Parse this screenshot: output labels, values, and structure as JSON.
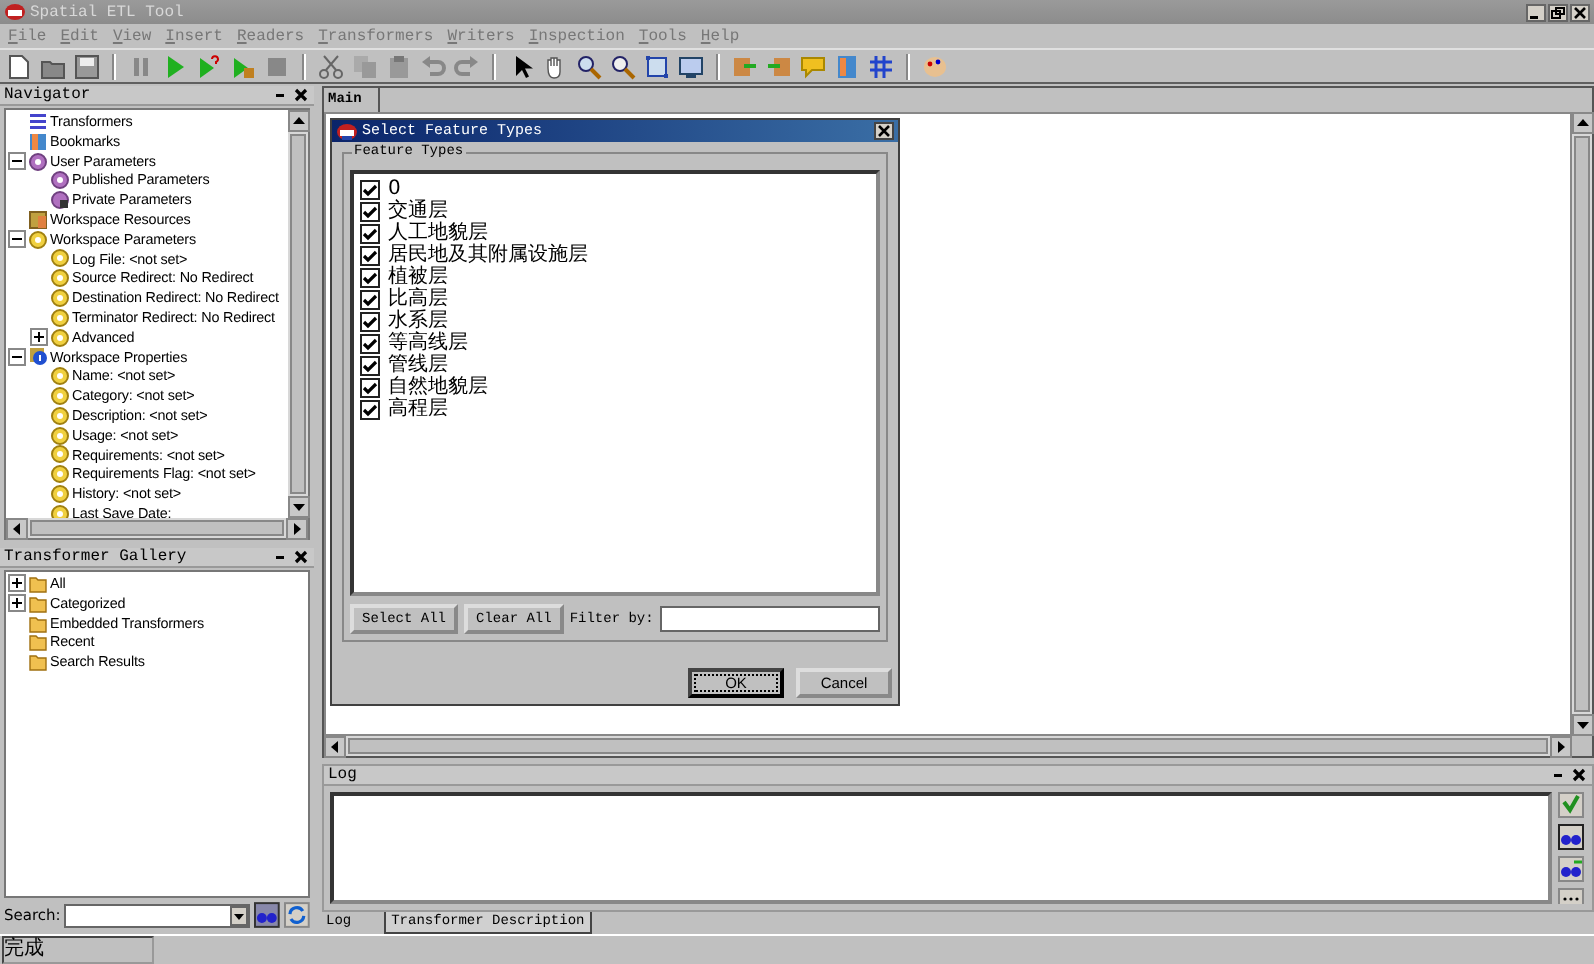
{
  "window": {
    "title": "Spatial ETL Tool"
  },
  "menu": [
    "File",
    "Edit",
    "View",
    "Insert",
    "Readers",
    "Transformers",
    "Writers",
    "Inspection",
    "Tools",
    "Help"
  ],
  "navigator": {
    "title": "Navigator",
    "items": [
      {
        "label": "Transformers",
        "kind": "list"
      },
      {
        "label": "Bookmarks",
        "kind": "book"
      },
      {
        "label": "User Parameters",
        "kind": "param",
        "expanded": true,
        "children": [
          {
            "label": "Published Parameters",
            "kind": "param"
          },
          {
            "label": "Private Parameters",
            "kind": "lockparam"
          }
        ]
      },
      {
        "label": "Workspace Resources",
        "kind": "resource"
      },
      {
        "label": "Workspace Parameters",
        "kind": "setting",
        "expanded": true,
        "children": [
          {
            "label": "Log File: <not set>",
            "kind": "setting"
          },
          {
            "label": "Source Redirect: No Redirect",
            "kind": "setting"
          },
          {
            "label": "Destination Redirect: No Redirect",
            "kind": "setting"
          },
          {
            "label": "Terminator Redirect: No Redirect",
            "kind": "setting"
          },
          {
            "label": "Advanced",
            "kind": "setting",
            "expanded": false
          }
        ]
      },
      {
        "label": "Workspace Properties",
        "kind": "info",
        "expanded": true,
        "children": [
          {
            "label": "Name: <not set>",
            "kind": "setting"
          },
          {
            "label": "Category: <not set>",
            "kind": "setting"
          },
          {
            "label": "Description: <not set>",
            "kind": "setting"
          },
          {
            "label": "Usage: <not set>",
            "kind": "setting"
          },
          {
            "label": "Requirements: <not set>",
            "kind": "setting"
          },
          {
            "label": "Requirements Flag: <not set>",
            "kind": "setting"
          },
          {
            "label": "History: <not set>",
            "kind": "setting"
          },
          {
            "label": "Last Save Date:",
            "kind": "setting"
          }
        ]
      }
    ]
  },
  "gallery": {
    "title": "Transformer Gallery",
    "items": [
      {
        "label": "All",
        "kind": "folder",
        "expanded": false
      },
      {
        "label": "Categorized",
        "kind": "folder",
        "expanded": false
      },
      {
        "label": "Embedded Transformers",
        "kind": "folder"
      },
      {
        "label": "Recent",
        "kind": "folder"
      },
      {
        "label": "Search Results",
        "kind": "folder"
      }
    ],
    "search_label": "Search:"
  },
  "main_tabs": [
    {
      "label": "Main",
      "selected": true
    }
  ],
  "dialog": {
    "title": "Select Feature Types",
    "group": "Feature Types",
    "items": [
      {
        "label": "0",
        "checked": true
      },
      {
        "label": "交通层",
        "checked": true
      },
      {
        "label": "人工地貌层",
        "checked": true
      },
      {
        "label": "居民地及其附属设施层",
        "checked": true
      },
      {
        "label": "植被层",
        "checked": true
      },
      {
        "label": "比高层",
        "checked": true
      },
      {
        "label": "水系层",
        "checked": true
      },
      {
        "label": "等高线层",
        "checked": true
      },
      {
        "label": "管线层",
        "checked": true
      },
      {
        "label": "自然地貌层",
        "checked": true
      },
      {
        "label": "高程层",
        "checked": true
      }
    ],
    "select_all": "Select All",
    "clear_all": "Clear All",
    "filter_label": "Filter by:",
    "ok": "OK",
    "cancel": "Cancel"
  },
  "log": {
    "title": "Log",
    "tabs": [
      {
        "label": "Log",
        "selected": true
      },
      {
        "label": "Transformer Description",
        "selected": false
      }
    ]
  },
  "status_bar": {
    "text": "完成"
  }
}
